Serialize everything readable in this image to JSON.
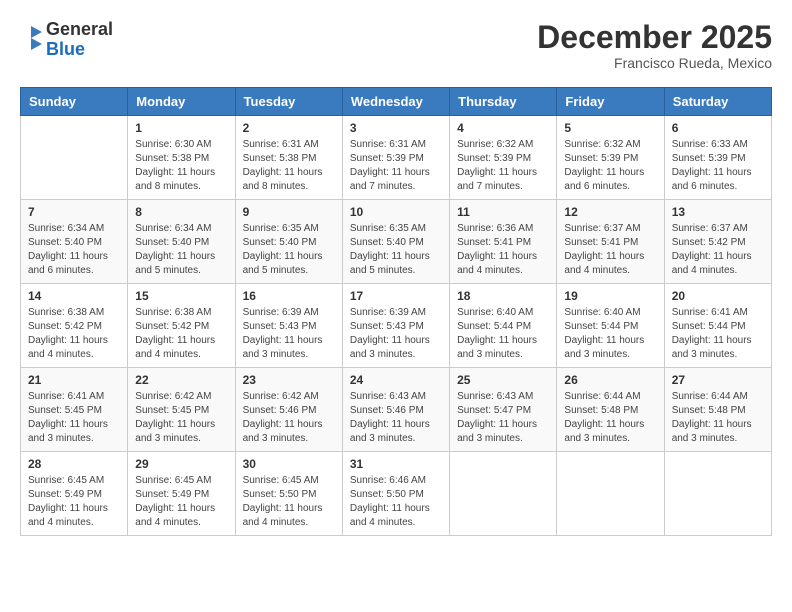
{
  "header": {
    "logo_general": "General",
    "logo_blue": "Blue",
    "month_title": "December 2025",
    "subtitle": "Francisco Rueda, Mexico"
  },
  "weekdays": [
    "Sunday",
    "Monday",
    "Tuesday",
    "Wednesday",
    "Thursday",
    "Friday",
    "Saturday"
  ],
  "weeks": [
    [
      {
        "day": "",
        "info": ""
      },
      {
        "day": "1",
        "info": "Sunrise: 6:30 AM\nSunset: 5:38 PM\nDaylight: 11 hours and 8 minutes."
      },
      {
        "day": "2",
        "info": "Sunrise: 6:31 AM\nSunset: 5:38 PM\nDaylight: 11 hours and 8 minutes."
      },
      {
        "day": "3",
        "info": "Sunrise: 6:31 AM\nSunset: 5:39 PM\nDaylight: 11 hours and 7 minutes."
      },
      {
        "day": "4",
        "info": "Sunrise: 6:32 AM\nSunset: 5:39 PM\nDaylight: 11 hours and 7 minutes."
      },
      {
        "day": "5",
        "info": "Sunrise: 6:32 AM\nSunset: 5:39 PM\nDaylight: 11 hours and 6 minutes."
      },
      {
        "day": "6",
        "info": "Sunrise: 6:33 AM\nSunset: 5:39 PM\nDaylight: 11 hours and 6 minutes."
      }
    ],
    [
      {
        "day": "7",
        "info": "Sunrise: 6:34 AM\nSunset: 5:40 PM\nDaylight: 11 hours and 6 minutes."
      },
      {
        "day": "8",
        "info": "Sunrise: 6:34 AM\nSunset: 5:40 PM\nDaylight: 11 hours and 5 minutes."
      },
      {
        "day": "9",
        "info": "Sunrise: 6:35 AM\nSunset: 5:40 PM\nDaylight: 11 hours and 5 minutes."
      },
      {
        "day": "10",
        "info": "Sunrise: 6:35 AM\nSunset: 5:40 PM\nDaylight: 11 hours and 5 minutes."
      },
      {
        "day": "11",
        "info": "Sunrise: 6:36 AM\nSunset: 5:41 PM\nDaylight: 11 hours and 4 minutes."
      },
      {
        "day": "12",
        "info": "Sunrise: 6:37 AM\nSunset: 5:41 PM\nDaylight: 11 hours and 4 minutes."
      },
      {
        "day": "13",
        "info": "Sunrise: 6:37 AM\nSunset: 5:42 PM\nDaylight: 11 hours and 4 minutes."
      }
    ],
    [
      {
        "day": "14",
        "info": "Sunrise: 6:38 AM\nSunset: 5:42 PM\nDaylight: 11 hours and 4 minutes."
      },
      {
        "day": "15",
        "info": "Sunrise: 6:38 AM\nSunset: 5:42 PM\nDaylight: 11 hours and 4 minutes."
      },
      {
        "day": "16",
        "info": "Sunrise: 6:39 AM\nSunset: 5:43 PM\nDaylight: 11 hours and 3 minutes."
      },
      {
        "day": "17",
        "info": "Sunrise: 6:39 AM\nSunset: 5:43 PM\nDaylight: 11 hours and 3 minutes."
      },
      {
        "day": "18",
        "info": "Sunrise: 6:40 AM\nSunset: 5:44 PM\nDaylight: 11 hours and 3 minutes."
      },
      {
        "day": "19",
        "info": "Sunrise: 6:40 AM\nSunset: 5:44 PM\nDaylight: 11 hours and 3 minutes."
      },
      {
        "day": "20",
        "info": "Sunrise: 6:41 AM\nSunset: 5:44 PM\nDaylight: 11 hours and 3 minutes."
      }
    ],
    [
      {
        "day": "21",
        "info": "Sunrise: 6:41 AM\nSunset: 5:45 PM\nDaylight: 11 hours and 3 minutes."
      },
      {
        "day": "22",
        "info": "Sunrise: 6:42 AM\nSunset: 5:45 PM\nDaylight: 11 hours and 3 minutes."
      },
      {
        "day": "23",
        "info": "Sunrise: 6:42 AM\nSunset: 5:46 PM\nDaylight: 11 hours and 3 minutes."
      },
      {
        "day": "24",
        "info": "Sunrise: 6:43 AM\nSunset: 5:46 PM\nDaylight: 11 hours and 3 minutes."
      },
      {
        "day": "25",
        "info": "Sunrise: 6:43 AM\nSunset: 5:47 PM\nDaylight: 11 hours and 3 minutes."
      },
      {
        "day": "26",
        "info": "Sunrise: 6:44 AM\nSunset: 5:48 PM\nDaylight: 11 hours and 3 minutes."
      },
      {
        "day": "27",
        "info": "Sunrise: 6:44 AM\nSunset: 5:48 PM\nDaylight: 11 hours and 3 minutes."
      }
    ],
    [
      {
        "day": "28",
        "info": "Sunrise: 6:45 AM\nSunset: 5:49 PM\nDaylight: 11 hours and 4 minutes."
      },
      {
        "day": "29",
        "info": "Sunrise: 6:45 AM\nSunset: 5:49 PM\nDaylight: 11 hours and 4 minutes."
      },
      {
        "day": "30",
        "info": "Sunrise: 6:45 AM\nSunset: 5:50 PM\nDaylight: 11 hours and 4 minutes."
      },
      {
        "day": "31",
        "info": "Sunrise: 6:46 AM\nSunset: 5:50 PM\nDaylight: 11 hours and 4 minutes."
      },
      {
        "day": "",
        "info": ""
      },
      {
        "day": "",
        "info": ""
      },
      {
        "day": "",
        "info": ""
      }
    ]
  ]
}
